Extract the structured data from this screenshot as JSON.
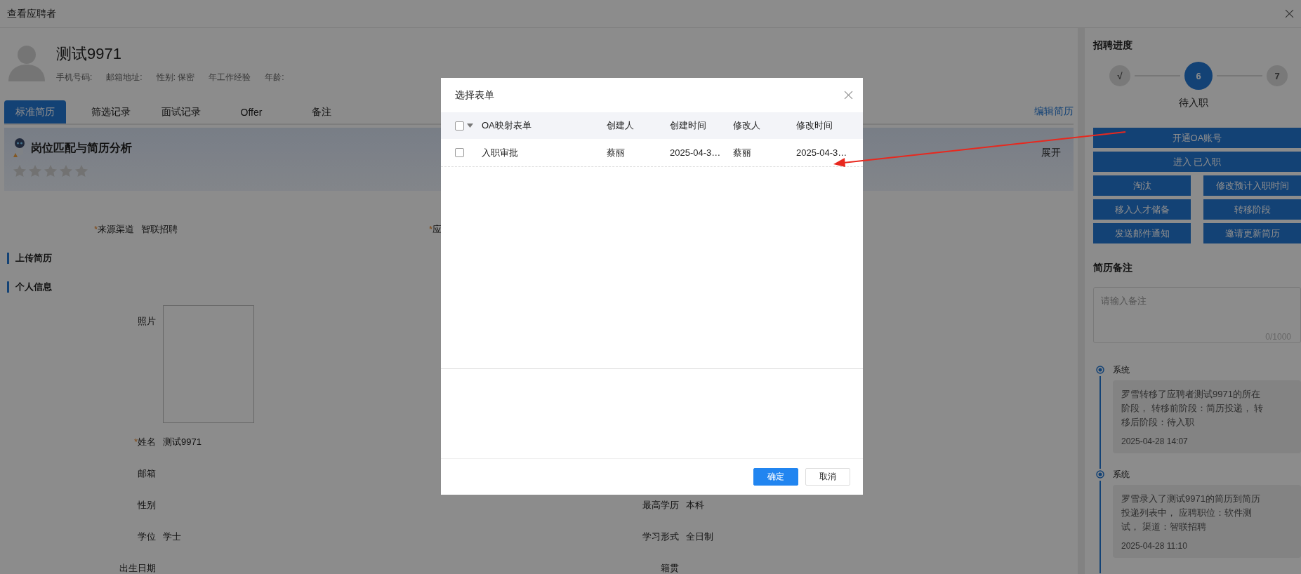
{
  "window": {
    "title": "查看应聘者"
  },
  "candidate": {
    "name": "测试9971",
    "info": [
      "手机号码:",
      "邮箱地址:",
      "性别: 保密",
      "年工作经验",
      "年龄:"
    ]
  },
  "tabs": [
    {
      "label": "标准简历",
      "selected": true
    },
    {
      "label": "筛选记录",
      "selected": false
    },
    {
      "label": "面试记录",
      "selected": false
    },
    {
      "label": "Offer",
      "selected": false
    },
    {
      "label": "备注",
      "selected": false
    }
  ],
  "edit_link": "编辑简历",
  "analysis": {
    "title": "岗位匹配与简历分析",
    "stars": 0,
    "expand": "展开"
  },
  "source_row": [
    {
      "mark": "*",
      "label": "来源渠道",
      "value": "智联招聘"
    },
    {
      "mark": "*",
      "label": "应"
    }
  ],
  "sections": [
    "上传简历",
    "个人信息"
  ],
  "photo_label": "照片",
  "personal_rows": [
    [
      {
        "mark": "*",
        "label": "姓名",
        "value": "测试9971"
      }
    ],
    [
      {
        "label": "邮箱"
      }
    ],
    [
      {
        "label": "性别"
      },
      {
        "label": "最高学历",
        "value": "本科"
      }
    ],
    [
      {
        "label": "学位",
        "value": "学士"
      },
      {
        "label": "学习形式",
        "value": "全日制"
      }
    ],
    [
      {
        "label": "出生日期"
      },
      {
        "label": "籍贯"
      }
    ]
  ],
  "progress": {
    "title": "招聘进度",
    "steps": [
      {
        "label": "√",
        "selected": false
      },
      {
        "label": "6",
        "selected": true
      },
      {
        "label": "7",
        "selected": false
      }
    ],
    "current_label": "待入职"
  },
  "actions": [
    {
      "label": "开通OA账号",
      "wide": true
    },
    {
      "label": "进入 已入职",
      "wide": true
    },
    {
      "label": "淘汰",
      "wide": false
    },
    {
      "label": "修改预计入职时间",
      "wide": false
    },
    {
      "label": "移入人才储备",
      "wide": false
    },
    {
      "label": "转移阶段",
      "wide": false
    },
    {
      "label": "发送邮件通知",
      "wide": false
    },
    {
      "label": "邀请更新简历",
      "wide": false
    }
  ],
  "notes": {
    "title": "简历备注",
    "placeholder": "请输入备注",
    "counter": "0/1000"
  },
  "timeline": [
    {
      "actor": "系统",
      "text": "罗雪转移了应聘者测试9971的所在阶段， 转移前阶段：简历投递， 转移后阶段：待入职",
      "time": "2025-04-28 14:07"
    },
    {
      "actor": "系统",
      "text": "罗雪录入了测试9971的简历到简历投递列表中， 应聘职位：软件测试， 渠道：智联招聘",
      "time": "2025-04-28 11:10"
    }
  ],
  "dialog": {
    "title": "选择表单",
    "columns": [
      "OA映射表单",
      "创建人",
      "创建时间",
      "修改人",
      "修改时间"
    ],
    "header_checked": false,
    "rows": [
      {
        "checked": false,
        "cells": [
          "入职审批",
          "蔡丽",
          "2025-04-3…",
          "蔡丽",
          "2025-04-3…"
        ]
      }
    ],
    "buttons": [
      {
        "label": "确定",
        "kind": "primary"
      },
      {
        "label": "取消",
        "kind": "default"
      }
    ]
  }
}
